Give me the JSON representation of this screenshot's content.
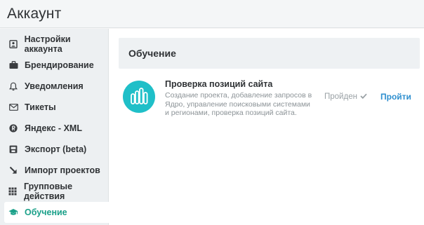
{
  "header": {
    "title": "Аккаунт"
  },
  "sidebar": {
    "items": [
      {
        "label": "Настройки аккаунта",
        "icon": "account-settings-icon"
      },
      {
        "label": "Брендирование",
        "icon": "briefcase-icon"
      },
      {
        "label": "Уведомления",
        "icon": "bell-icon"
      },
      {
        "label": "Тикеты",
        "icon": "envelope-icon"
      },
      {
        "label": "Яндекс - XML",
        "icon": "yandex-icon"
      },
      {
        "label": "Экспорт (beta)",
        "icon": "export-icon"
      },
      {
        "label": "Импорт проектов",
        "icon": "import-arrow-icon"
      },
      {
        "label": "Групповые действия",
        "icon": "grid-icon"
      },
      {
        "label": "Обучение",
        "icon": "graduation-cap-icon",
        "active": true
      }
    ]
  },
  "main": {
    "section_title": "Обучение",
    "course": {
      "title": "Проверка позиций сайта",
      "description": "Создание проекта, добавление запросов в Ядро, управление поисковыми системами и регионами, проверка позиций сайта.",
      "status": "Пройден",
      "action": "Пройти",
      "logo_color": "#1fbfc8"
    }
  },
  "colors": {
    "accent": "#1aa089",
    "link": "#2e8fcf"
  }
}
